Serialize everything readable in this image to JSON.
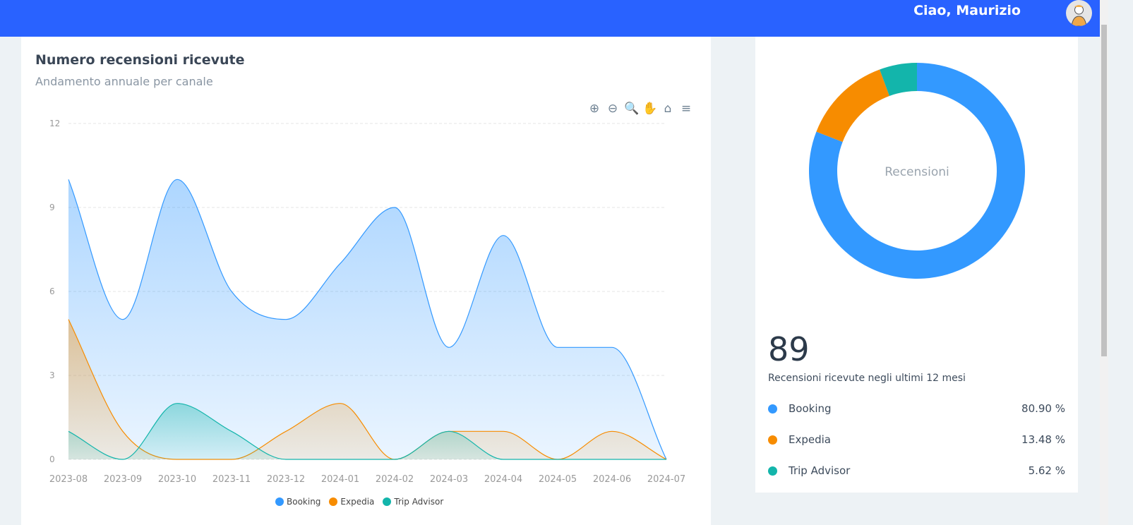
{
  "header": {
    "greeting": "Ciao, Maurizio"
  },
  "chart_card": {
    "title": "Numero recensioni ricevute",
    "subtitle": "Andamento annuale per canale"
  },
  "toolbar": [
    {
      "name": "zoom-in-icon",
      "glyph": "⊕"
    },
    {
      "name": "zoom-out-icon",
      "glyph": "⊖"
    },
    {
      "name": "selection-zoom-icon",
      "glyph": "🔍"
    },
    {
      "name": "pan-hand-icon",
      "glyph": "✋"
    },
    {
      "name": "reset-home-icon",
      "glyph": "⌂"
    },
    {
      "name": "menu-icon",
      "glyph": "≡"
    }
  ],
  "chart_data": {
    "type": "area",
    "x": [
      "2023-08",
      "2023-09",
      "2023-10",
      "2023-11",
      "2023-12",
      "2024-01",
      "2024-02",
      "2024-03",
      "2024-04",
      "2024-05",
      "2024-06",
      "2024-07"
    ],
    "yticks": [
      0,
      3,
      6,
      9,
      12
    ],
    "ylim": [
      0,
      12
    ],
    "grid": true,
    "legend": "bottom",
    "series": [
      {
        "name": "Booking",
        "color": "#3399ff",
        "values": [
          10,
          5,
          10,
          6,
          5,
          7,
          9,
          4,
          8,
          4,
          4,
          0
        ]
      },
      {
        "name": "Expedia",
        "color": "#f78c00",
        "values": [
          5,
          1,
          0,
          0,
          1,
          2,
          0,
          1,
          1,
          0,
          1,
          0
        ]
      },
      {
        "name": "Trip Advisor",
        "color": "#13b5ab",
        "values": [
          1,
          0,
          2,
          1,
          0,
          0,
          0,
          1,
          0,
          0,
          0,
          0
        ]
      }
    ]
  },
  "donut": {
    "center_label": "Recensioni",
    "total": "89",
    "description": "Recensioni ricevute negli ultimi 12 mesi",
    "items": [
      {
        "label": "Booking",
        "pct": "80.90 %",
        "value": 80.9,
        "color": "#3399ff"
      },
      {
        "label": "Expedia",
        "pct": "13.48 %",
        "value": 13.48,
        "color": "#f78c00"
      },
      {
        "label": "Trip Advisor",
        "pct": "5.62 %",
        "value": 5.62,
        "color": "#13b5ab"
      }
    ]
  }
}
